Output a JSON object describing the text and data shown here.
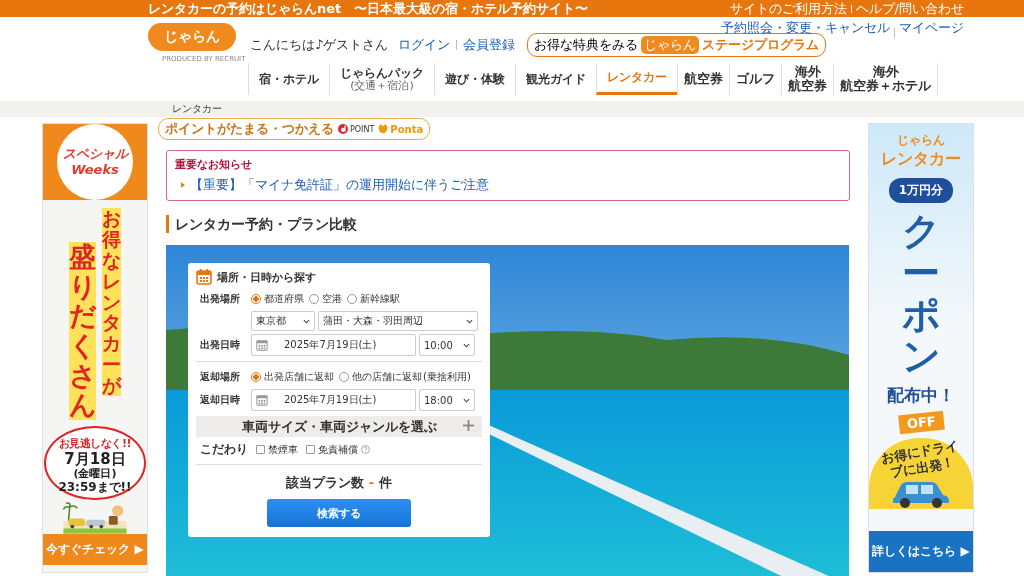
{
  "top_bar": {
    "tagline": "レンタカーの予約はじゃらんnet　〜日本最大級の宿・ホテル予約サイト〜",
    "links": [
      "サイトのご利用方法",
      "ヘルプ/問い合わせ"
    ]
  },
  "header": {
    "logo": "じゃらん",
    "logo_caption": "PRODUCED BY RECRUIT",
    "greeting": "こんにちは♪ゲストさん",
    "links": [
      "ログイン",
      "会員登録"
    ],
    "stage_program": {
      "lead": "お得な特典をみる",
      "logo": "じゃらん",
      "label": "ステージプログラム"
    },
    "account_links": [
      "予約照会・変更・キャンセル",
      "マイページ"
    ]
  },
  "nav": [
    {
      "kind": "regular",
      "lines": [
        "宿・ホテル"
      ],
      "selected": false
    },
    {
      "kind": "regular",
      "lines": [
        "じゃらんパック"
      ],
      "note": "(交通＋宿泊)",
      "selected": false
    },
    {
      "kind": "regular",
      "lines": [
        "遊び・体験"
      ],
      "selected": false
    },
    {
      "kind": "regular",
      "lines": [
        "観光ガイド"
      ],
      "selected": false
    },
    {
      "kind": "regular",
      "lines": [
        "レンタカー"
      ],
      "selected": true
    },
    {
      "kind": "compact",
      "lines": [
        "航空券"
      ],
      "selected": false
    },
    {
      "kind": "compact",
      "lines": [
        "ゴルフ"
      ],
      "selected": false
    },
    {
      "kind": "compact",
      "lines": [
        "海外",
        "航空券"
      ],
      "selected": false
    },
    {
      "kind": "compact",
      "lines": [
        "海外",
        "航空券＋ホテル"
      ],
      "selected": false
    }
  ],
  "breadcrumb": [
    "レンタカー"
  ],
  "points_badge": {
    "label": "ポイントがたまる・つかえる",
    "brands": [
      "POINT",
      "Ponta"
    ]
  },
  "notice": {
    "title": "重要なお知らせ",
    "items": [
      "【重要】「マイナ免許証」の運用開始に伴うご注意"
    ]
  },
  "page_title": "レンタカー予約・プラン比較",
  "search": {
    "title": "場所・日時から探す",
    "departure_place": {
      "label": "出発場所",
      "options": [
        {
          "label": "都道府県",
          "selected": true
        },
        {
          "label": "空港",
          "selected": false
        },
        {
          "label": "新幹線駅",
          "selected": false
        }
      ],
      "prefecture": "東京都",
      "area": "蒲田・大森・羽田周辺"
    },
    "departure_datetime": {
      "label": "出発日時",
      "date": "2025年7月19日(土)",
      "time": "10:00"
    },
    "return_place": {
      "label": "返却場所",
      "options": [
        {
          "label": "出発店舗に返却",
          "selected": true
        },
        {
          "label": "他の店舗に返却",
          "note": "(乗捨利用)",
          "selected": false
        }
      ]
    },
    "return_datetime": {
      "label": "返却日時",
      "date": "2025年7月19日(土)",
      "time": "18:00"
    },
    "vehicle_toggle": {
      "label": "車両サイズ・車両ジャンルを選ぶ",
      "expanded": false
    },
    "preferences": {
      "label": "こだわり",
      "options": [
        {
          "label": "禁煙車",
          "checked": false,
          "help": false
        },
        {
          "label": "免責補償",
          "checked": false,
          "help": true
        }
      ]
    },
    "plan_count": {
      "label": "該当プラン数",
      "count": "-",
      "unit": "件"
    },
    "button": "検索する"
  },
  "left_banner": {
    "logo_lines": [
      "スペシャル",
      "Weeks"
    ],
    "columns": [
      "お得なレンタカーが",
      "盛りだくさん"
    ],
    "deadline": {
      "lead": "お見逃しなく!!",
      "date": "7月18日",
      "weekday": "(金曜日)",
      "time": "23:59まで!!"
    },
    "button": "今すぐチェック ▶"
  },
  "right_banner": {
    "brand": "じゃらん",
    "title": "レンタカー",
    "amount": "1万円分",
    "headline": "クーポン",
    "subline": "配布中！",
    "ticket": "OFF",
    "slogan": "お得にドライブに出発！",
    "button": "詳しくはこちら ▶"
  }
}
